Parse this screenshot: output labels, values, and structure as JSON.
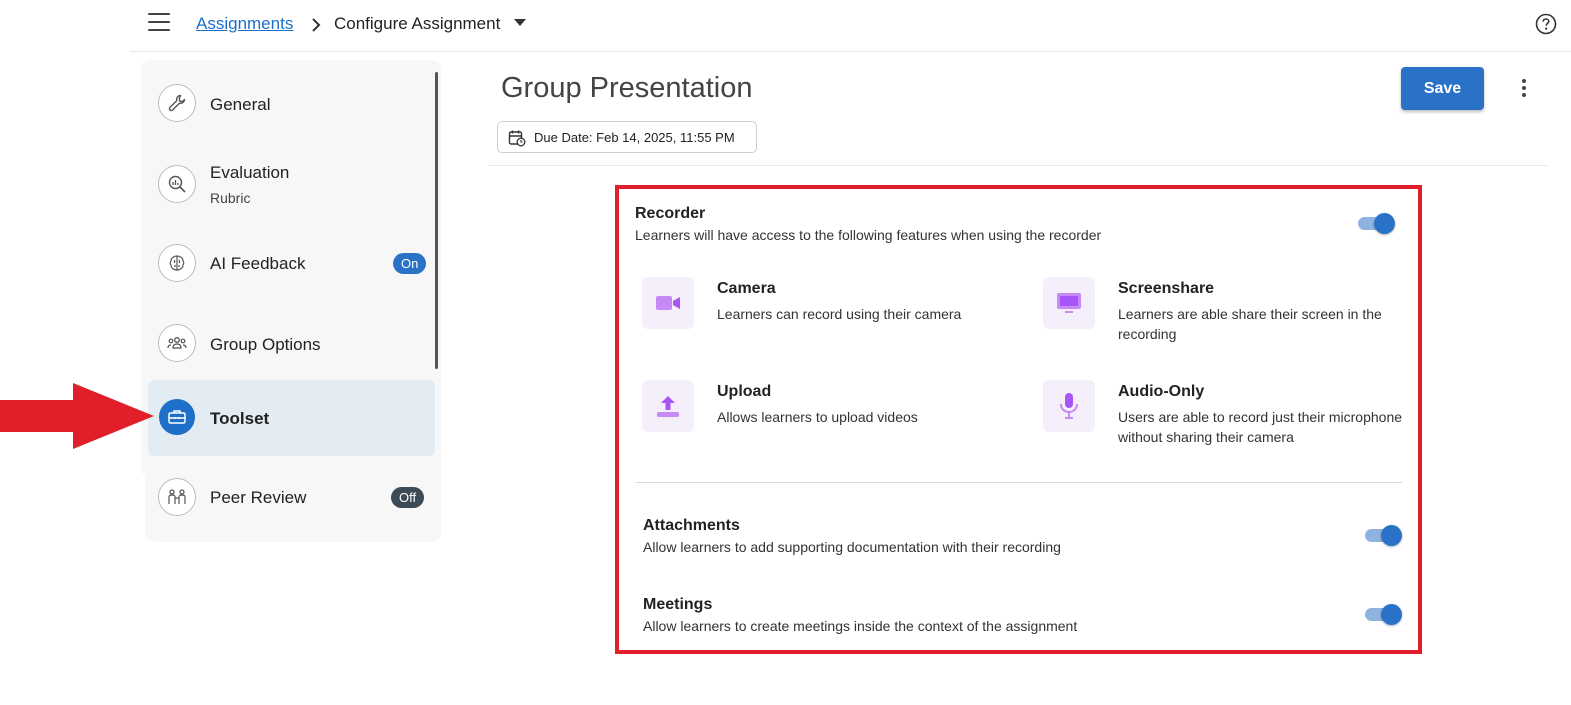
{
  "breadcrumb": {
    "link": "Assignments",
    "current": "Configure Assignment"
  },
  "sidebar": {
    "items": [
      {
        "label": "General",
        "icon": "wrench-icon"
      },
      {
        "label": "Evaluation",
        "sub": "Rubric",
        "icon": "magnifier-chart-icon"
      },
      {
        "label": "AI Feedback",
        "badge": "On",
        "icon": "brain-icon"
      },
      {
        "label": "Group Options",
        "icon": "group-icon"
      },
      {
        "label": "Toolset",
        "icon": "toolbox-icon",
        "active": true
      },
      {
        "label": "Peer Review",
        "badge": "Off",
        "icon": "peers-icon"
      }
    ]
  },
  "main": {
    "title": "Group Presentation",
    "save_label": "Save",
    "due_date": "Due Date: Feb 14, 2025, 11:55 PM"
  },
  "recorder": {
    "title": "Recorder",
    "description": "Learners will have access to the following features when using the recorder",
    "enabled": true,
    "features": [
      {
        "title": "Camera",
        "description": "Learners can record using their camera",
        "icon": "video-camera-icon"
      },
      {
        "title": "Screenshare",
        "description": "Learners are able share their screen in the recording",
        "icon": "monitor-icon"
      },
      {
        "title": "Upload",
        "description": "Allows learners to upload videos",
        "icon": "upload-icon"
      },
      {
        "title": "Audio-Only",
        "description": "Users are able to record just their microphone without sharing their camera",
        "icon": "microphone-icon"
      }
    ]
  },
  "attachments": {
    "title": "Attachments",
    "description": "Allow learners to add supporting documentation with their recording",
    "enabled": true
  },
  "meetings": {
    "title": "Meetings",
    "description": "Allow learners to create meetings inside the context of the assignment",
    "enabled": true
  },
  "colors": {
    "accent": "#2a72c8",
    "highlight_border": "#e01f2a",
    "feature_icon": "#a855f7",
    "badge_on": "#2a72c8",
    "badge_off": "#3d4b56"
  }
}
